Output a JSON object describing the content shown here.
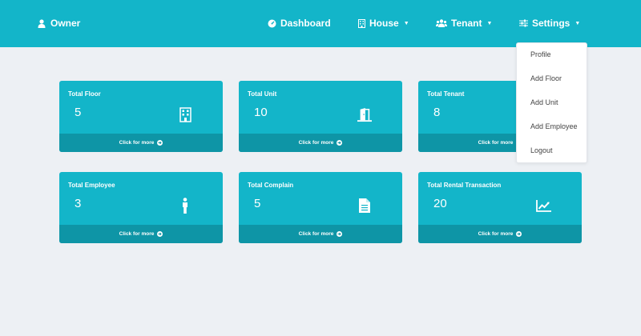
{
  "header": {
    "brand": {
      "label": "Owner",
      "icon": "user-icon"
    },
    "nav": [
      {
        "label": "Dashboard",
        "icon": "gauge-icon"
      },
      {
        "label": "House",
        "icon": "building-icon"
      },
      {
        "label": "Tenant",
        "icon": "users-icon"
      },
      {
        "label": "Settings",
        "icon": "sliders-icon"
      }
    ]
  },
  "settings_menu": {
    "items": [
      "Profile",
      "Add Floor",
      "Add Unit",
      "Add Employee",
      "Logout"
    ]
  },
  "cards": [
    {
      "title": "Total Floor",
      "value": "5",
      "icon": "building-icon",
      "footer": "Click for more"
    },
    {
      "title": "Total Unit",
      "value": "10",
      "icon": "door-open-icon",
      "footer": "Click for more"
    },
    {
      "title": "Total Tenant",
      "value": "8",
      "icon": "users-icon",
      "footer": "Click for more"
    },
    {
      "title": "Total Employee",
      "value": "3",
      "icon": "person-icon",
      "footer": "Click for more"
    },
    {
      "title": "Total Complain",
      "value": "5",
      "icon": "file-icon",
      "footer": "Click for more"
    },
    {
      "title": "Total Rental Transaction",
      "value": "20",
      "icon": "chart-line-icon",
      "footer": "Click for more"
    }
  ],
  "colors": {
    "primary": "#13b5c9",
    "footer": "#0e95a6",
    "background": "#edf0f4",
    "menu_text": "#444444"
  }
}
